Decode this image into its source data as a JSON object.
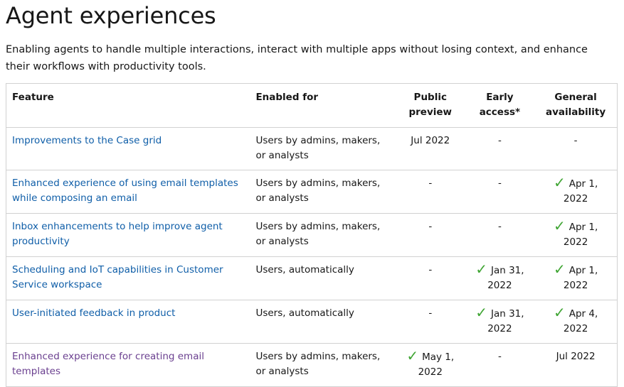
{
  "title": "Agent experiences",
  "intro": "Enabling agents to handle multiple interactions, interact with multiple apps without losing context, and enhance their workflows with productivity tools.",
  "table": {
    "headers": {
      "feature": "Feature",
      "enabled_for": "Enabled for",
      "public_preview_1": "Public",
      "public_preview_2": "preview",
      "early_access_1": "Early",
      "early_access_2": "access*",
      "general_availability_1": "General",
      "general_availability_2": "availability"
    },
    "rows": [
      {
        "feature": "Improvements to the Case grid",
        "enabled_for": "Users by admins, makers, or analysts",
        "public_preview": "Jul 2022",
        "early_access": "-",
        "general_availability": "-"
      },
      {
        "feature": "Enhanced experience of using email templates while composing an email",
        "enabled_for": "Users by admins, makers, or analysts",
        "public_preview": "-",
        "early_access": "-",
        "general_availability": "Apr 1, 2022"
      },
      {
        "feature": "Inbox enhancements to help improve agent productivity",
        "enabled_for": "Users by admins, makers, or analysts",
        "public_preview": "-",
        "early_access": "-",
        "general_availability": "Apr 1, 2022"
      },
      {
        "feature": "Scheduling and IoT capabilities in Customer Service workspace",
        "enabled_for": "Users, automatically",
        "public_preview": "-",
        "early_access": "Jan 31, 2022",
        "general_availability": "Apr 1, 2022"
      },
      {
        "feature": "User-initiated feedback in product",
        "enabled_for": "Users, automatically",
        "public_preview": "-",
        "early_access": "Jan 31, 2022",
        "general_availability": "Apr 4, 2022"
      },
      {
        "feature": "Enhanced experience for creating email templates",
        "enabled_for": "Users by admins, makers, or analysts",
        "public_preview": "May 1, 2022",
        "early_access": "-",
        "general_availability": "Jul 2022"
      }
    ]
  },
  "colors": {
    "link": "#0f5ea8",
    "visited_link": "#6a3f8f",
    "check": "#3fa533",
    "border": "#d1d1d1"
  },
  "icons": {
    "check": "checkmark-icon"
  }
}
